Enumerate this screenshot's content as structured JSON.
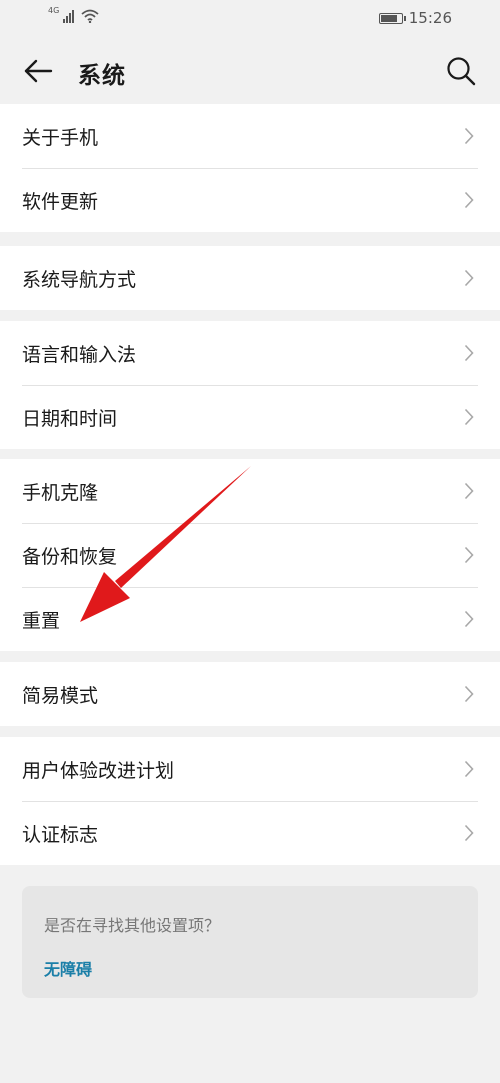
{
  "status_bar": {
    "network": "4G",
    "time": "15:26",
    "battery_level": 0.85
  },
  "header": {
    "title": "系统"
  },
  "groups": [
    {
      "items": [
        {
          "label": "关于手机"
        },
        {
          "label": "软件更新"
        }
      ]
    },
    {
      "items": [
        {
          "label": "系统导航方式"
        }
      ]
    },
    {
      "items": [
        {
          "label": "语言和输入法"
        },
        {
          "label": "日期和时间"
        }
      ]
    },
    {
      "items": [
        {
          "label": "手机克隆"
        },
        {
          "label": "备份和恢复"
        },
        {
          "label": "重置"
        }
      ]
    },
    {
      "items": [
        {
          "label": "简易模式"
        }
      ]
    },
    {
      "items": [
        {
          "label": "用户体验改进计划"
        },
        {
          "label": "认证标志"
        }
      ]
    }
  ],
  "suggestion": {
    "question": "是否在寻找其他设置项？",
    "link": "无障碍"
  },
  "colors": {
    "background": "#f1f1f1",
    "link": "#1b7fa8",
    "annotation_arrow": "#e0191b"
  }
}
